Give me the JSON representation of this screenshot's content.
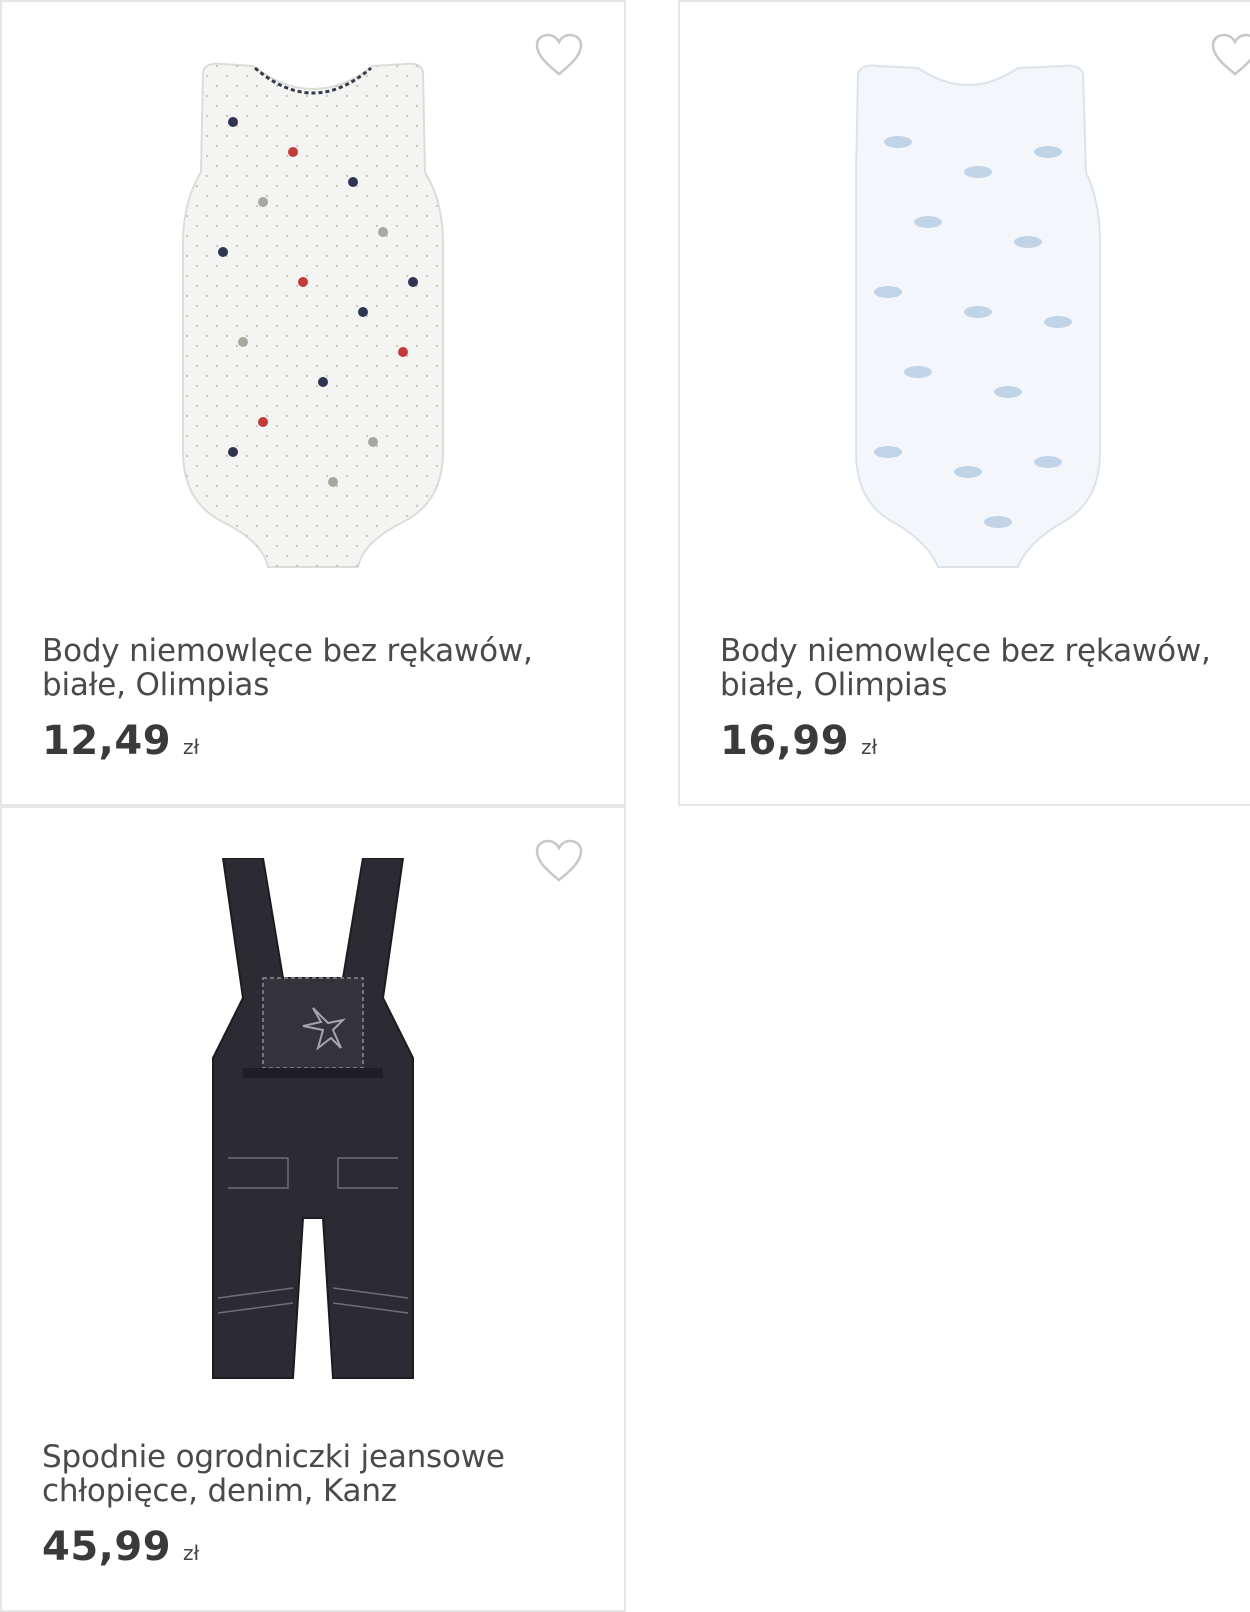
{
  "products": [
    {
      "title": "Body niemowlęce bez rękawów, białe, Olimpias",
      "price": "12,49",
      "currency": "zł",
      "image": "white-sleeveless-bodysuit-paisley"
    },
    {
      "title": "Body niemowlęce bez rękawów, białe, Olimpias",
      "price": "16,99",
      "currency": "zł",
      "image": "white-sleeveless-bodysuit-blue-print"
    },
    {
      "title": "Spodnie ogrodniczki jeansowe chłopięce, denim, Kanz",
      "price": "45,99",
      "currency": "zł",
      "image": "denim-dungarees-airplane"
    }
  ],
  "icons": {
    "favorite": "heart-outline-icon"
  },
  "colors": {
    "border": "#e6e6e6",
    "text": "#4a4a4a",
    "heart": "#c8c8c8"
  }
}
